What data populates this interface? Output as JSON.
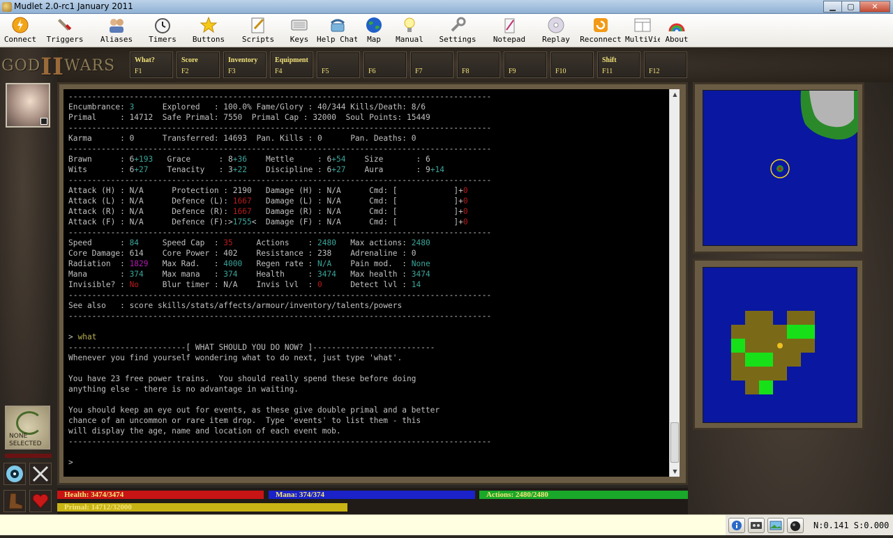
{
  "window": {
    "title": "Mudlet 2.0-rc1 January 2011",
    "min": "▁",
    "max": "▢",
    "close": "✕"
  },
  "toolbar": [
    {
      "label": "Connect",
      "icon": "connect-icon"
    },
    {
      "label": "Triggers",
      "icon": "triggers-icon"
    },
    {
      "label": "Aliases",
      "icon": "aliases-icon"
    },
    {
      "label": "Timers",
      "icon": "timers-icon"
    },
    {
      "label": "Buttons",
      "icon": "buttons-icon"
    },
    {
      "label": "Scripts",
      "icon": "scripts-icon"
    },
    {
      "label": "Keys",
      "icon": "keys-icon"
    },
    {
      "label": "Help Chat",
      "icon": "help-chat-icon"
    },
    {
      "label": "Map",
      "icon": "map-icon"
    },
    {
      "label": "Manual",
      "icon": "manual-icon"
    },
    {
      "label": "Settings",
      "icon": "settings-icon"
    },
    {
      "label": "Notepad",
      "icon": "notepad-icon"
    },
    {
      "label": "Replay",
      "icon": "replay-icon"
    },
    {
      "label": "Reconnect",
      "icon": "reconnect-icon"
    },
    {
      "label": "MultiView",
      "icon": "multiview-icon"
    },
    {
      "label": "About",
      "icon": "about-icon"
    }
  ],
  "logo": {
    "left": "GOD",
    "two": "II",
    "right": "WARS"
  },
  "fkeys": [
    {
      "caption": "What?",
      "key": "F1"
    },
    {
      "caption": "Score",
      "key": "F2"
    },
    {
      "caption": "Inventory",
      "key": "F3"
    },
    {
      "caption": "Equipment",
      "key": "F4"
    },
    {
      "caption": "",
      "key": "F5"
    },
    {
      "caption": "",
      "key": "F6"
    },
    {
      "caption": "",
      "key": "F7"
    },
    {
      "caption": "",
      "key": "F8"
    },
    {
      "caption": "",
      "key": "F9"
    },
    {
      "caption": "",
      "key": "F10"
    },
    {
      "caption": "Shift",
      "key": "F11"
    },
    {
      "caption": "",
      "key": "F12"
    }
  ],
  "target": {
    "line1": "NONE",
    "line2": "SELECTED"
  },
  "console": {
    "separator": "------------------------------------------------------------------------------------------",
    "score": {
      "encumbrance": "3",
      "explored": "100.0%",
      "fame": "40/344",
      "kills": "8/6",
      "primal": "14712",
      "safe_primal": "7550",
      "primal_cap": "32000",
      "soul_points": "15449",
      "karma": "0",
      "transferred": "14693",
      "pan_kills": "0",
      "pan_deaths": "0",
      "brawn": "6",
      "brawn_bonus": "+193",
      "grace": "8",
      "grace_bonus": "+36",
      "mettle": "6",
      "mettle_bonus": "+54",
      "size": "6",
      "wits": "6",
      "wits_bonus": "+27",
      "tenacity": "3",
      "tenacity_bonus": "+22",
      "discipline": "6",
      "discipline_bonus": "+27",
      "aura": "9",
      "aura_bonus": "+14",
      "attack_h": "N/A",
      "attack_l": "N/A",
      "attack_r": "N/A",
      "attack_f": "N/A",
      "protection": "2190",
      "defence_l": "1667",
      "defence_r": "1667",
      "defence_f": "1755",
      "damage_h": "N/A",
      "damage_l": "N/A",
      "damage_r": "N/A",
      "damage_f": "N/A",
      "cmd_suffix": "0",
      "speed": "84",
      "speed_cap": "35",
      "actions": "2480",
      "max_actions": "2480",
      "core_damage": "614",
      "core_power": "402",
      "resistance": "238",
      "adrenaline": "0",
      "radiation": "1829",
      "max_rad": "4000",
      "regen_rate": "N/A",
      "pain_mod": "None",
      "mana": "374",
      "max_mana": "374",
      "health": "3474",
      "max_health": "3474",
      "invisible": "No",
      "blur_timer": "N/A",
      "invis_lvl": "0",
      "detect_lvl": "14",
      "see_also": "score skills/stats/affects/armour/inventory/talents/powers"
    },
    "command": "what",
    "what_header": "-------------------------[ WHAT SHOULD YOU DO NOW? ]--------------------------",
    "what_line1": "Whenever you find yourself wondering what to do next, just type 'what'.",
    "what_line2": "You have 23 free power trains.  You should really spend these before doing",
    "what_line3": "anything else - there is no advantage in waiting.",
    "what_line4a": "You should keep an eye out for events, as these give double primal and a better",
    "what_line4b": "chance of an uncommon or rare item drop.  Type 'events' to list them - this",
    "what_line4c": "will display the age, name and location of each event mob.",
    "prompt": ">"
  },
  "bars": {
    "health": {
      "label": "Health: 3474/3474",
      "fraction": 1.0,
      "color": "#c81414"
    },
    "mana": {
      "label": "Mana: 374/374",
      "fraction": 1.0,
      "color": "#1a22c8"
    },
    "actions": {
      "label": "Actions: 2480/2480",
      "fraction": 1.0,
      "color": "#1aa82a"
    },
    "primal": {
      "label": "Primal: 14712/32000",
      "fraction": 0.4598,
      "color": "#c8b414"
    }
  },
  "cmdline": {
    "value": ""
  },
  "net_status": "N:0.141 S:0.000",
  "colors": {
    "console_bg": "#000000",
    "frame": "#6a5c44",
    "map_water": "#0a17a0",
    "map_ground": "#7a6a18",
    "map_grass": "#18e018"
  }
}
